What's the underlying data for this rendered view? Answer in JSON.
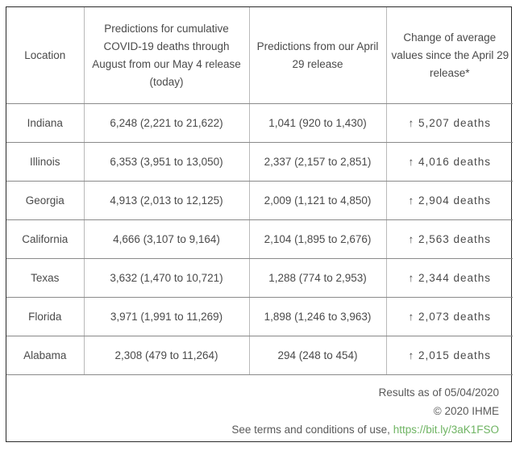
{
  "table": {
    "headers": [
      {
        "lines": [
          "Location"
        ]
      },
      {
        "lines": [
          "Predictions for cumulative",
          "COVID-19 deaths through",
          "August from our May 4 release",
          "(today)"
        ]
      },
      {
        "lines": [
          "Predictions from our April",
          "29 release"
        ]
      },
      {
        "lines": [
          "Change of average",
          "values since the April 29",
          "release*"
        ]
      }
    ],
    "rows": [
      {
        "location": "Indiana",
        "may4": "6,248 (2,221 to 21,622)",
        "apr29": "1,041 (920 to 1,430)",
        "change": "↑ 5,207 deaths"
      },
      {
        "location": "Illinois",
        "may4": "6,353 (3,951 to 13,050)",
        "apr29": "2,337 (2,157 to 2,851)",
        "change": "↑ 4,016 deaths"
      },
      {
        "location": "Georgia",
        "may4": "4,913 (2,013 to 12,125)",
        "apr29": "2,009 (1,121 to 4,850)",
        "change": "↑ 2,904 deaths"
      },
      {
        "location": "California",
        "may4": "4,666 (3,107 to 9,164)",
        "apr29": "2,104 (1,895 to 2,676)",
        "change": "↑ 2,563 deaths"
      },
      {
        "location": "Texas",
        "may4": "3,632 (1,470 to 10,721)",
        "apr29": "1,288 (774 to 2,953)",
        "change": "↑ 2,344 deaths"
      },
      {
        "location": "Florida",
        "may4": "3,971 (1,991 to 11,269)",
        "apr29": "1,898 (1,246 to 3,963)",
        "change": "↑ 2,073 deaths"
      },
      {
        "location": "Alabama",
        "may4": "2,308 (479 to 11,264)",
        "apr29": "294 (248 to 454)",
        "change": "↑ 2,015 deaths"
      }
    ]
  },
  "footer": {
    "results_as_of": "Results as of 05/04/2020",
    "copyright": "© 2020 IHME",
    "terms_prefix": "See terms and conditions of use, ",
    "terms_link": "https://bit.ly/3aK1FSO"
  },
  "colors": {
    "text": "#4a4a4a",
    "link": "#6fb463",
    "outer_border": "#2b2b2b",
    "grid_horizontal": "#8a8a8a",
    "grid_vertical": "#b9b9b9"
  }
}
